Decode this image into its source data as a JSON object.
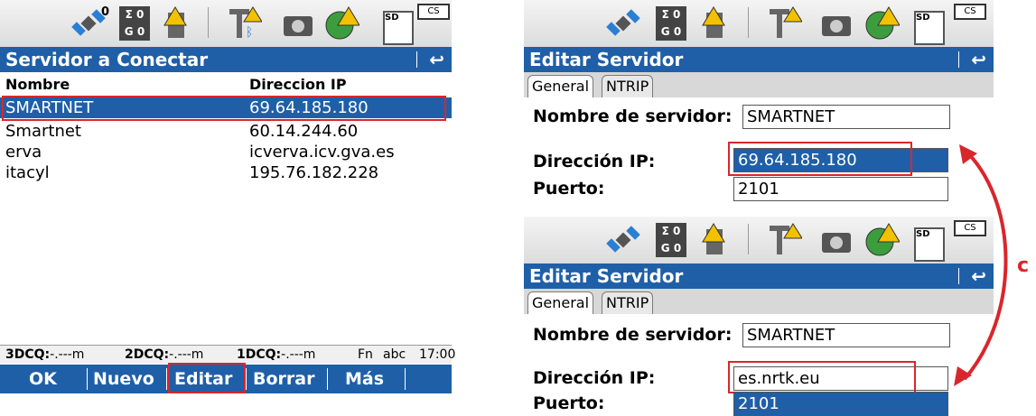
{
  "left": {
    "title": "Servidor a Conectar",
    "col_name": "Nombre",
    "col_ip": "Direccion IP",
    "rows": [
      {
        "name": "SMARTNET",
        "ip": "69.64.185.180"
      },
      {
        "name": "Smartnet",
        "ip": "60.14.244.60"
      },
      {
        "name": "erva",
        "ip": "icverva.icv.gva.es"
      },
      {
        "name": "itacyl",
        "ip": "195.76.182.228"
      }
    ],
    "footer": {
      "q3_label": "3DCQ:",
      "q3_val": "-.---m",
      "q2_label": "2DCQ:",
      "q2_val": "-.---m",
      "q1_label": "1DCQ:",
      "q1_val": "-.---m",
      "fn": "Fn",
      "mode": "abc",
      "time": "17:00"
    },
    "softkeys": [
      "OK",
      "Nuevo",
      "Editar",
      "Borrar",
      "Más"
    ]
  },
  "status": {
    "sigma_top": "Σ 0",
    "sigma_bottom": "G 0",
    "sat_count": "0",
    "sd_label": "SD",
    "cs_label": "CS"
  },
  "edit_top": {
    "title": "Editar Servidor",
    "tab_general": "General",
    "tab_ntrip": "NTRIP",
    "name_label": "Nombre de servidor:",
    "name_value": "SMARTNET",
    "ip_label": "Dirección IP:",
    "ip_value": "69.64.185.180",
    "port_label": "Puerto:",
    "port_value": "2101"
  },
  "edit_bottom": {
    "title": "Editar Servidor",
    "tab_general": "General",
    "tab_ntrip": "NTRIP",
    "name_label": "Nombre de servidor:",
    "name_value": "SMARTNET",
    "ip_label": "Dirección IP:",
    "ip_value": "es.nrtk.eu",
    "port_label": "Puerto:",
    "port_value": "2101"
  },
  "side_letter": "c",
  "colors": {
    "accent": "#1f5fa8",
    "highlight": "#d9262c"
  }
}
